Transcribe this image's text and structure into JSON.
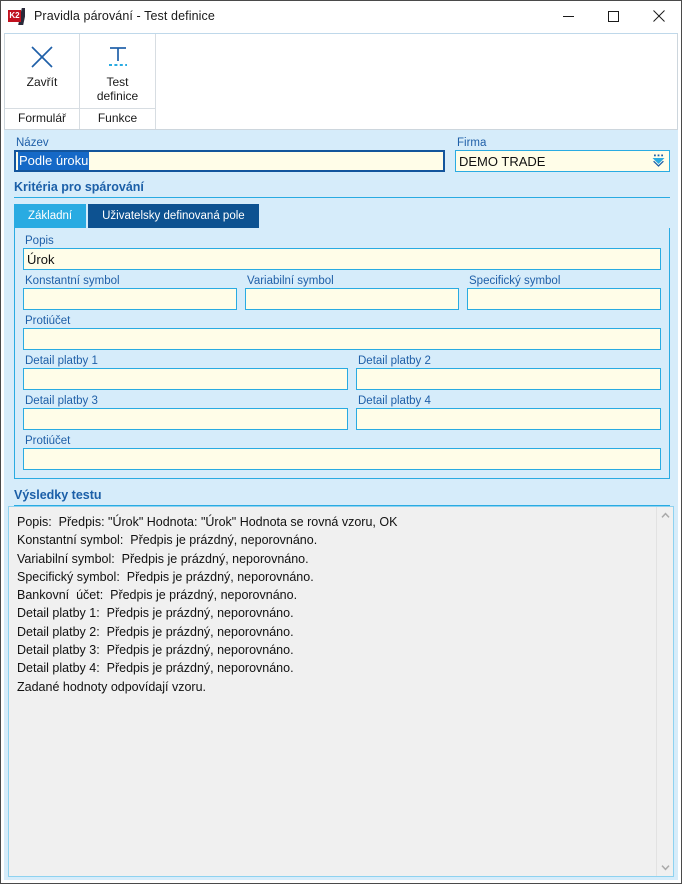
{
  "window": {
    "title": "Pravidla párování - Test definice",
    "app_icon": "k2-logo-icon",
    "k2_mark": "K2",
    "minimize_label": "minimize-icon",
    "maximize_label": "maximize-icon",
    "close_label": "close-icon"
  },
  "ribbon": {
    "groups": [
      {
        "icon": "close-x-icon",
        "label": "Zavřít",
        "footer": "Formulář"
      },
      {
        "icon": "text-definition-icon",
        "label": "Test\ndefinice",
        "footer": "Funkce"
      }
    ],
    "zavrit_label": "Zavřít",
    "formular_label": "Formulář",
    "test_definice_label_line1": "Test",
    "test_definice_label_line2": "definice",
    "funkce_label": "Funkce"
  },
  "form": {
    "name_label": "Název",
    "name_value": "Podle úroku",
    "firma_label": "Firma",
    "firma_value": "DEMO TRADE",
    "firma_dropdown_icon": "k2-lookup-chevron-icon"
  },
  "criteria": {
    "section_title": "Kritéria pro spárování",
    "tabs": [
      {
        "label": "Základní",
        "active": true
      },
      {
        "label": "Uživatelsky definovaná pole",
        "active": false
      }
    ],
    "tab_basic": "Základní",
    "tab_userfields": "Uživatelsky definovaná pole",
    "fields": {
      "popis_label": "Popis",
      "popis_value": "Úrok",
      "konstantni_label": "Konstantní symbol",
      "konstantni_value": "",
      "variabilni_label": "Variabilní symbol",
      "variabilni_value": "",
      "specificky_label": "Specifický symbol",
      "specificky_value": "",
      "protiucet1_label": "Protiúčet",
      "protiucet1_value": "",
      "detail1_label": "Detail platby 1",
      "detail1_value": "",
      "detail2_label": "Detail platby 2",
      "detail2_value": "",
      "detail3_label": "Detail platby 3",
      "detail3_value": "",
      "detail4_label": "Detail platby 4",
      "detail4_value": "",
      "protiucet2_label": "Protiúčet",
      "protiucet2_value": ""
    }
  },
  "results": {
    "title": "Výsledky testu",
    "lines": [
      "Popis:  Předpis: \"Úrok\" Hodnota: \"Úrok\" Hodnota se rovná vzoru, OK",
      "Konstantní symbol:  Předpis je prázdný, neporovnáno.",
      "Variabilní symbol:  Předpis je prázdný, neporovnáno.",
      "Specifický symbol:  Předpis je prázdný, neporovnáno.",
      "Bankovní  účet:  Předpis je prázdný, neporovnáno.",
      "Detail platby 1:  Předpis je prázdný, neporovnáno.",
      "Detail platby 2:  Předpis je prázdný, neporovnáno.",
      "Detail platby 3:  Předpis je prázdný, neporovnáno.",
      "Detail platby 4:  Předpis je prázdný, neporovnáno.",
      "Zadané hodnoty odpovídají vzoru."
    ],
    "text": "Popis:  Předpis: \"Úrok\" Hodnota: \"Úrok\" Hodnota se rovná vzoru, OK\nKonstantní symbol:  Předpis je prázdný, neporovnáno.\nVariabilní symbol:  Předpis je prázdný, neporovnáno.\nSpecifický symbol:  Předpis je prázdný, neporovnáno.\nBankovní  účet:  Předpis je prázdný, neporovnáno.\nDetail platby 1:  Předpis je prázdný, neporovnáno.\nDetail platby 2:  Předpis je prázdný, neporovnáno.\nDetail platby 3:  Předpis je prázdný, neporovnáno.\nDetail platby 4:  Předpis je prázdný, neporovnáno.\nZadané hodnoty odpovídají vzoru.",
    "scroll_up_icon": "chevron-up-icon",
    "scroll_down_icon": "chevron-down-icon"
  },
  "colors": {
    "accent_cyan": "#29abe2",
    "accent_dark_blue": "#0d5291",
    "label_blue": "#1f5fa8",
    "panel_bg": "#d6ecfa",
    "field_bg": "#fffde8",
    "selection_blue": "#1569c7",
    "results_bg": "#f0f0f0"
  }
}
